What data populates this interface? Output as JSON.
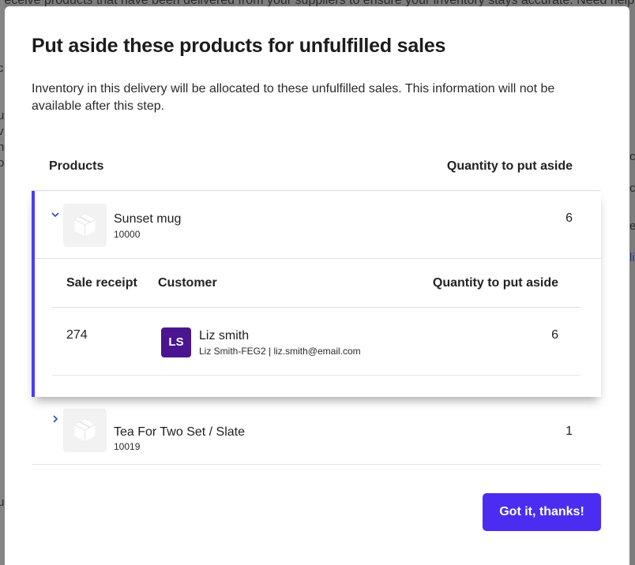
{
  "background": {
    "banner_text": "receive products that have been delivered from your suppliers to ensure your inventory stays accurate. Need help",
    "left_fragments": [
      "c",
      "i",
      "u",
      "v",
      "h",
      "o",
      "u"
    ],
    "right_fragments": [
      "c",
      "c",
      "e",
      "li"
    ]
  },
  "modal": {
    "title": "Put aside these products for unfulfilled sales",
    "description": "Inventory in this delivery will be allocated to these unfulfilled sales. This information will not be available after this step.",
    "table": {
      "col_products": "Products",
      "col_quantity": "Quantity to put aside"
    },
    "products": [
      {
        "name": "Sunset mug",
        "sku": "10000",
        "quantity": "6",
        "expanded": true,
        "sales_table": {
          "col_receipt": "Sale receipt",
          "col_customer": "Customer",
          "col_quantity": "Quantity to put aside"
        },
        "sales": [
          {
            "receipt": "274",
            "initials": "LS",
            "customer_name": "Liz smith",
            "customer_detail": "Liz Smith-FEG2 | liz.smith@email.com",
            "quantity": "6"
          }
        ]
      },
      {
        "name": "Tea For Two Set / Slate",
        "sku": "10019",
        "quantity": "1",
        "expanded": false
      }
    ],
    "confirm_button": "Got it, thanks!"
  },
  "colors": {
    "accent": "#4b3cf5",
    "button": "#4b2df2",
    "avatar": "#4a1590",
    "chevron": "#2e48b8"
  },
  "icons": {
    "expand": "chevron-down-icon",
    "collapse": "chevron-right-icon",
    "product_placeholder": "box-icon"
  }
}
